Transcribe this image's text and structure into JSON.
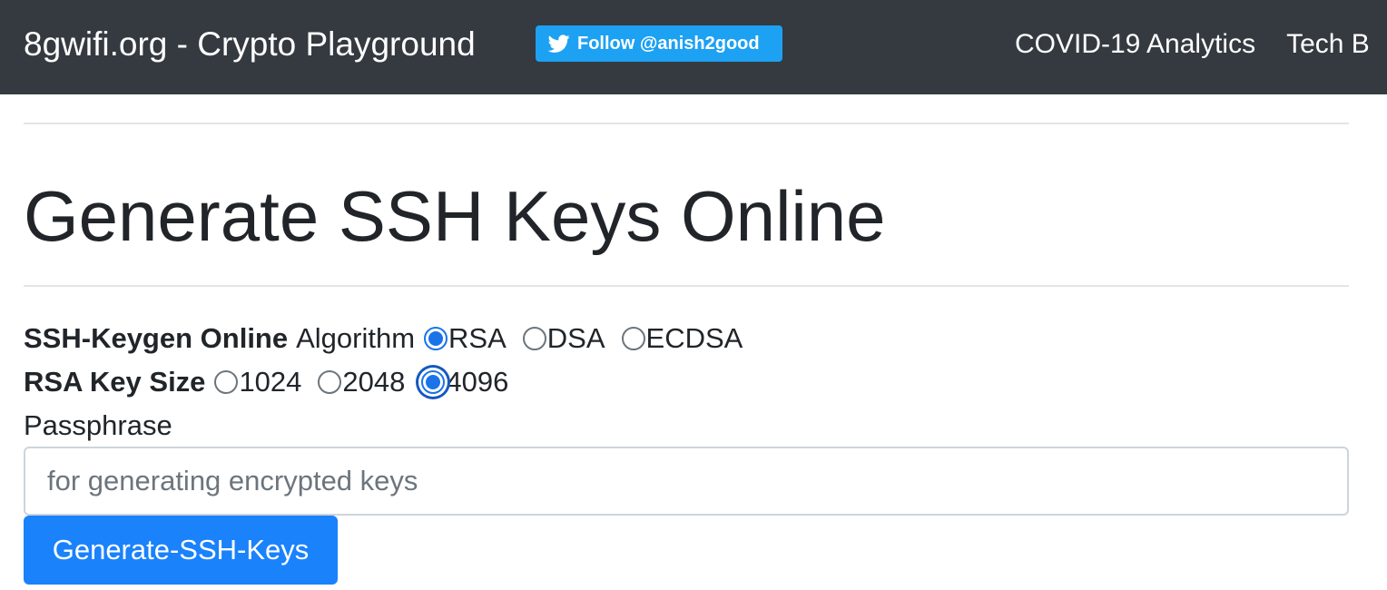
{
  "navbar": {
    "brand": "8gwifi.org - Crypto Playground",
    "twitter_button": "Follow @anish2good",
    "links": [
      "COVID-19 Analytics",
      "Tech B"
    ]
  },
  "page": {
    "title": "Generate SSH Keys Online"
  },
  "algorithm": {
    "heading": "SSH-Keygen Online",
    "label": "Algorithm",
    "options": [
      "RSA",
      "DSA",
      "ECDSA"
    ],
    "selected": "RSA"
  },
  "key_size": {
    "heading": "RSA Key Size",
    "options": [
      "1024",
      "2048",
      "4096"
    ],
    "selected": "4096"
  },
  "passphrase": {
    "label": "Passphrase",
    "placeholder": "for generating encrypted keys",
    "value": ""
  },
  "submit": {
    "label": "Generate-SSH-Keys"
  },
  "colors": {
    "navbar_bg": "#343a40",
    "twitter_blue": "#1da1f2",
    "primary": "#1a82fb"
  }
}
